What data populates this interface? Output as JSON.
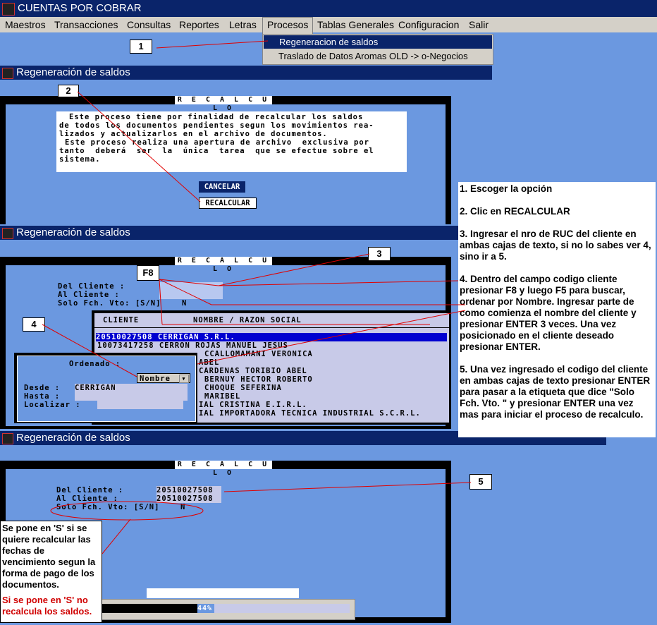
{
  "app_title": "CUENTAS POR COBRAR",
  "menu": [
    "Maestros",
    "Transacciones",
    "Consultas",
    "Reportes",
    "Letras",
    "Procesos",
    "Tablas Generales",
    "Configuracion",
    "Salir"
  ],
  "dropdown": [
    "Regeneracion de saldos",
    "Traslado de Datos Aromas OLD -> o-Negocios"
  ],
  "window_title": "Regeneración de saldos",
  "recalculo_header": "R E C A L C U L O",
  "intro_text": [
    "Este proceso tiene por finalidad de recalcular los saldos",
    "de todos los documentos pendientes segun los movimientos rea-",
    "lizados y actualizarlos en el archivo de documentos.",
    "",
    "Este proceso realiza una apertura de archivo  exclusiva por",
    "tanto  deberá  ser  la  única  tarea  que se efectue sobre el",
    "sistema."
  ],
  "btn_cancelar": "CANCELAR",
  "btn_recalcular": "RECALCULAR",
  "field_labels": {
    "del": "Del Cliente :",
    "al": "Al  Cliente :",
    "solo": "Solo Fch. Vto: [S/N]"
  },
  "solo_value": "N",
  "list_headers": {
    "cliente": "CLIENTE",
    "nombre": "NOMBRE / RAZON SOCIAL"
  },
  "list_rows": [
    "20510027508 CERRIGAN S.R.L.",
    "10073417258 CERRON ROJAS MANUEL JESUS",
    "CCALLOMAMANI VERONICA",
    "ABEL",
    "CARDENAS TORIBIO ABEL",
    "BERNUY HECTOR ROBERTO",
    "CHOQUE SEFERINA",
    "MARIBEL",
    "IAL CRISTINA E.I.R.L.",
    "IAL IMPORTADORA TECNICA INDUSTRIAL S.C.R.L."
  ],
  "search": {
    "ordenado": "Ordenado :",
    "combo": "Nombre",
    "desde": "Desde :",
    "desde_val": "CERRIGAN",
    "hasta": "Hasta :",
    "localizar": "Localizar :"
  },
  "filled": {
    "del_val": "20510027508",
    "al_val": "20510027508"
  },
  "progress": {
    "label": "44%",
    "value": 0.44
  },
  "callouts": [
    "1",
    "2",
    "3",
    "4",
    "5",
    "F8"
  ],
  "instructions": [
    "1. Escoger la opción",
    "2. Clic en RECALCULAR",
    "3. Ingresar el nro de RUC del cliente en ambas cajas de texto, si no lo sabes ver 4, sino ir a 5.",
    "4. Dentro del campo codigo cliente presionar F8 y luego F5 para buscar, ordenar por Nombre. Ingresar parte de como comienza el nombre del cliente y presionar ENTER 3 veces. Una vez posicionado en el cliente deseado presionar ENTER.",
    "5. Una vez ingresado el codigo del cliente en ambas cajas de texto presionar ENTER para pasar a la etiqueta que dice \"Solo Fch. Vto. \" y presionar ENTER una vez mas para iniciar el proceso de recalculo."
  ],
  "side_note": "Se pone en 'S' si se quiere recalcular las fechas de vencimiento segun la forma de pago de los documentos.",
  "side_note_red": "Si se pone en 'S' no recalcula los saldos."
}
